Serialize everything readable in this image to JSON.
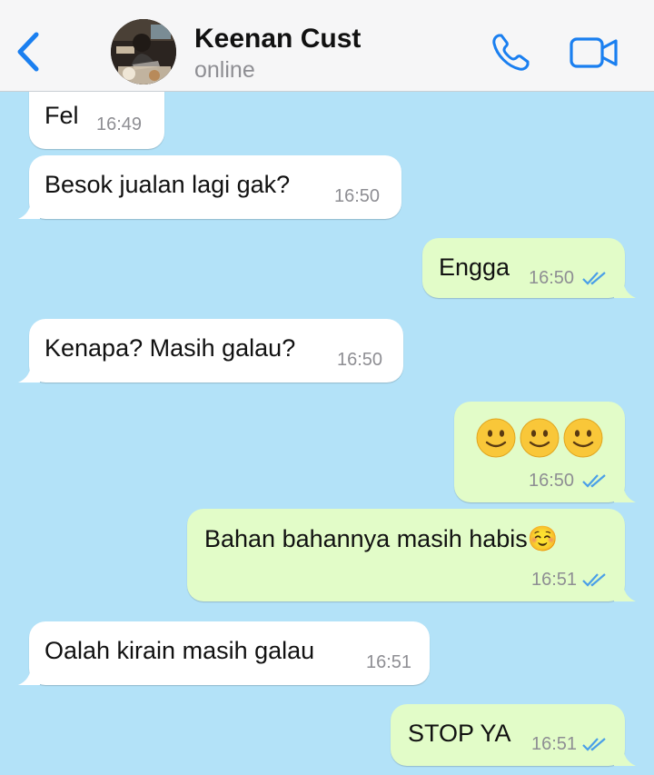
{
  "header": {
    "contact_name": "Keenan Cust",
    "status": "online"
  },
  "colors": {
    "chat_background": "#b3e2f8",
    "incoming_bubble": "#ffffff",
    "outgoing_bubble": "#e2fcc8",
    "accent": "#1a7ff0",
    "read_ticks": "#4a9fe8"
  },
  "icons": {
    "back": "chevron-left-icon",
    "call": "phone-icon",
    "video": "video-camera-icon",
    "read_receipt": "double-check-icon",
    "emoji_smile": "slightly-smiling-face-emoji",
    "emoji_relieved": "smiling-face-emoji"
  },
  "messages": [
    {
      "dir": "in",
      "text": "Fel",
      "time": "16:49"
    },
    {
      "dir": "in",
      "text": "Besok jualan lagi gak?",
      "time": "16:50"
    },
    {
      "dir": "out",
      "text": "Engga",
      "time": "16:50",
      "read": true
    },
    {
      "dir": "in",
      "text": "Kenapa? Masih galau?",
      "time": "16:50"
    },
    {
      "dir": "out",
      "text": "🙂🙂🙂",
      "time": "16:50",
      "read": true
    },
    {
      "dir": "out",
      "text": "Bahan bahannya masih habis☺️",
      "time": "16:51",
      "read": true
    },
    {
      "dir": "in",
      "text": "Oalah kirain masih galau",
      "time": "16:51"
    },
    {
      "dir": "out",
      "text": "STOP YA",
      "time": "16:51",
      "read": true
    }
  ]
}
